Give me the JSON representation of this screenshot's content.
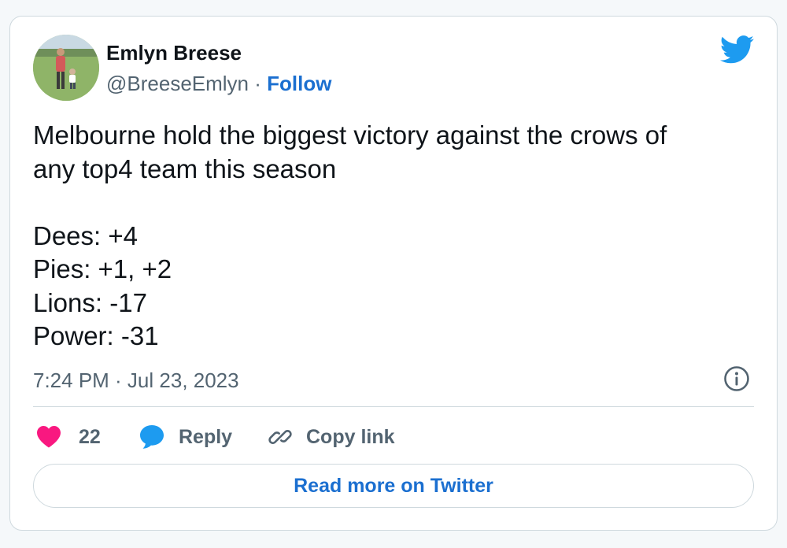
{
  "author": {
    "name": "Emlyn Breese",
    "handle": "@BreeseEmlyn",
    "separator": " · ",
    "follow_label": "Follow"
  },
  "tweet": {
    "lines": [
      "Melbourne hold the biggest victory against the crows of",
      "any top4 team this season",
      "",
      "Dees: +4",
      "Pies: +1, +2",
      "Lions: -17",
      "Power: -31"
    ],
    "timestamp": "7:24 PM · Jul 23, 2023"
  },
  "actions": {
    "like_count": "22",
    "reply_label": "Reply",
    "copy_link_label": "Copy link"
  },
  "read_more_label": "Read more on Twitter",
  "icons": {
    "logo": "twitter-bird-icon",
    "info": "info-icon",
    "like": "heart-icon",
    "reply": "speech-bubble-icon",
    "copy": "link-icon"
  },
  "colors": {
    "twitter_blue": "#1d9bf0",
    "link_blue": "#1b6fd0",
    "heart_pink": "#f91880",
    "text_primary": "#0f1419",
    "text_secondary": "#536471",
    "border": "#cfd9de"
  }
}
